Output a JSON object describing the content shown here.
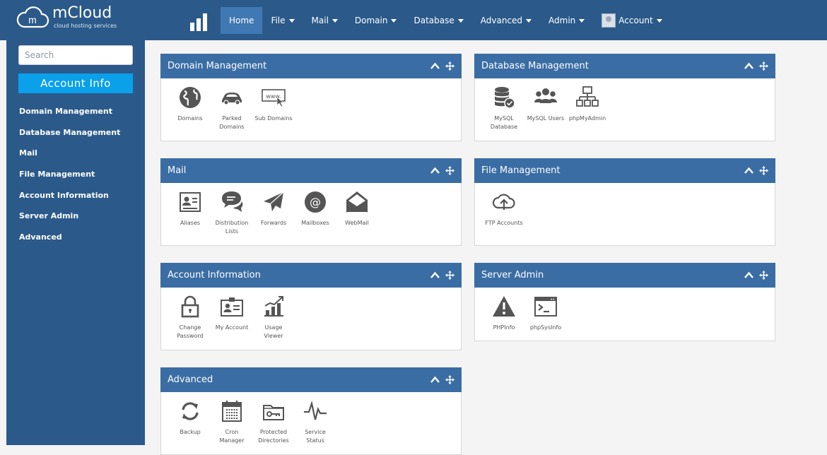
{
  "brand": {
    "name": "mCloud",
    "tagline": "cloud hosting services",
    "logo_letter": "m",
    "color": "#2b5a8a"
  },
  "nav": [
    {
      "label": "Home",
      "active": true,
      "dropdown": false
    },
    {
      "label": "File",
      "dropdown": true
    },
    {
      "label": "Mail",
      "dropdown": true
    },
    {
      "label": "Domain",
      "dropdown": true
    },
    {
      "label": "Database",
      "dropdown": true
    },
    {
      "label": "Advanced",
      "dropdown": true
    },
    {
      "label": "Admin",
      "dropdown": true
    },
    {
      "label": "Account",
      "dropdown": true,
      "avatar": true
    }
  ],
  "sidebar": {
    "search_placeholder": "Search",
    "account_button": "Account Info",
    "links": [
      "Domain Management",
      "Database Management",
      "Mail",
      "File Management",
      "Account Information",
      "Server Admin",
      "Advanced"
    ]
  },
  "panels": {
    "domain": {
      "title": "Domain Management",
      "items": [
        {
          "label": "Domains",
          "icon": "globe-icon"
        },
        {
          "label": "Parked Domains",
          "icon": "car-icon"
        },
        {
          "label": "Sub Domains",
          "icon": "www-icon"
        }
      ]
    },
    "database": {
      "title": "Database Management",
      "items": [
        {
          "label": "MySQL Database",
          "icon": "database-icon"
        },
        {
          "label": "MySQL Users",
          "icon": "users-icon"
        },
        {
          "label": "phpMyAdmin",
          "icon": "sitemap-icon"
        }
      ]
    },
    "mail": {
      "title": "Mail",
      "items": [
        {
          "label": "Aliases",
          "icon": "contact-card-icon"
        },
        {
          "label": "Distribution Lists",
          "icon": "chat-bubbles-icon"
        },
        {
          "label": "Forwards",
          "icon": "paper-plane-icon"
        },
        {
          "label": "Mailboxes",
          "icon": "at-sign-icon"
        },
        {
          "label": "WebMail",
          "icon": "open-envelope-icon"
        }
      ]
    },
    "file": {
      "title": "File Management",
      "items": [
        {
          "label": "FTP Accounts",
          "icon": "cloud-upload-icon"
        }
      ]
    },
    "account": {
      "title": "Account Information",
      "items": [
        {
          "label": "Change Password",
          "icon": "lock-icon"
        },
        {
          "label": "My Account",
          "icon": "id-card-icon"
        },
        {
          "label": "Usage Viewer",
          "icon": "bar-chart-icon"
        }
      ]
    },
    "server": {
      "title": "Server Admin",
      "items": [
        {
          "label": "PHPInfo",
          "icon": "warning-icon"
        },
        {
          "label": "phpSysInfo",
          "icon": "terminal-icon"
        }
      ]
    },
    "advanced": {
      "title": "Advanced",
      "items": [
        {
          "label": "Backup",
          "icon": "refresh-icon"
        },
        {
          "label": "Cron Manager",
          "icon": "calendar-icon"
        },
        {
          "label": "Protected Directories",
          "icon": "folder-key-icon"
        },
        {
          "label": "Service Status",
          "icon": "pulse-icon"
        }
      ]
    }
  }
}
